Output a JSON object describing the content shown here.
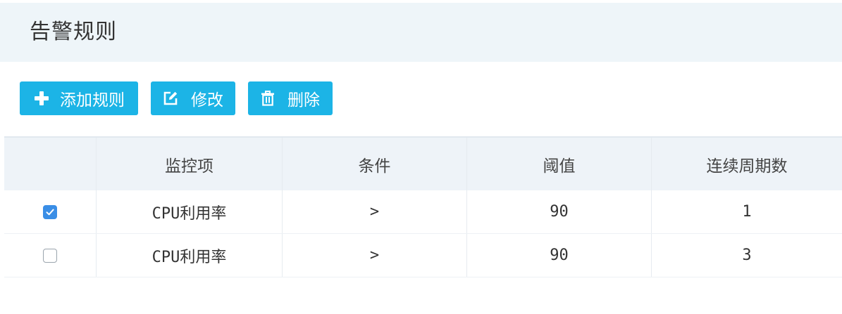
{
  "header": {
    "title": "告警规则"
  },
  "toolbar": {
    "add_label": "添加规则",
    "edit_label": "修改",
    "delete_label": "删除"
  },
  "table": {
    "columns": [
      "",
      "监控项",
      "条件",
      "阈值",
      "连续周期数"
    ],
    "rows": [
      {
        "checked": true,
        "metric": "CPU利用率",
        "condition": ">",
        "threshold": "90",
        "periods": "1"
      },
      {
        "checked": false,
        "metric": "CPU利用率",
        "condition": ">",
        "threshold": "90",
        "periods": "3"
      }
    ]
  },
  "colors": {
    "button": "#1cb4e6",
    "header_bg": "#eef5f9",
    "table_head_bg": "#eef3f8",
    "checkbox_checked": "#3a8ee6"
  },
  "icons": {
    "add": "plus-icon",
    "edit": "edit-icon",
    "delete": "trash-icon"
  }
}
